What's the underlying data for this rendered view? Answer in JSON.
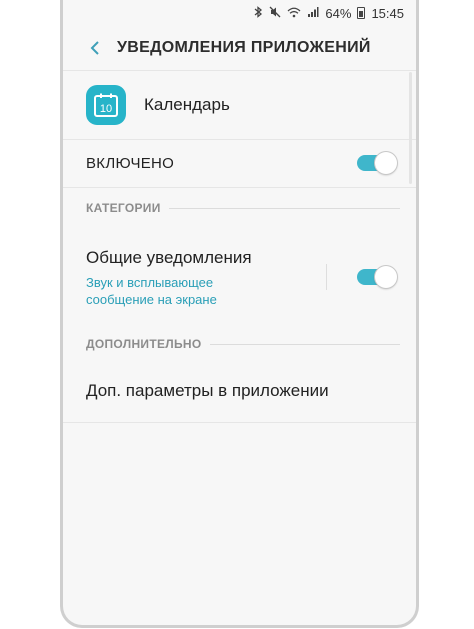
{
  "status_bar": {
    "icons": [
      "bluetooth-icon",
      "mute-icon",
      "wifi-icon",
      "signal-icon",
      "battery-icon"
    ],
    "battery": "64%",
    "time": "15:45"
  },
  "header": {
    "title": "УВЕДОМЛЕНИЯ ПРИЛОЖЕНИЙ",
    "back_icon": "chevron-left-icon"
  },
  "app": {
    "name": "Календарь",
    "icon_day": "10",
    "icon_color": "#27b4c9"
  },
  "enabled": {
    "label": "ВКЛЮЧЕНО",
    "on": true
  },
  "categories": {
    "header": "КАТЕГОРИИ",
    "items": [
      {
        "title": "Общие уведомления",
        "subtitle": "Звук и всплывающее сообщение на экране",
        "on": true
      }
    ]
  },
  "advanced": {
    "header": "ДОПОЛНИТЕЛЬНО",
    "item": "Доп. параметры в приложении"
  },
  "colors": {
    "accent": "#3fb6cb",
    "subtitle": "#2a9fb7",
    "background": "#f7f7f7"
  }
}
